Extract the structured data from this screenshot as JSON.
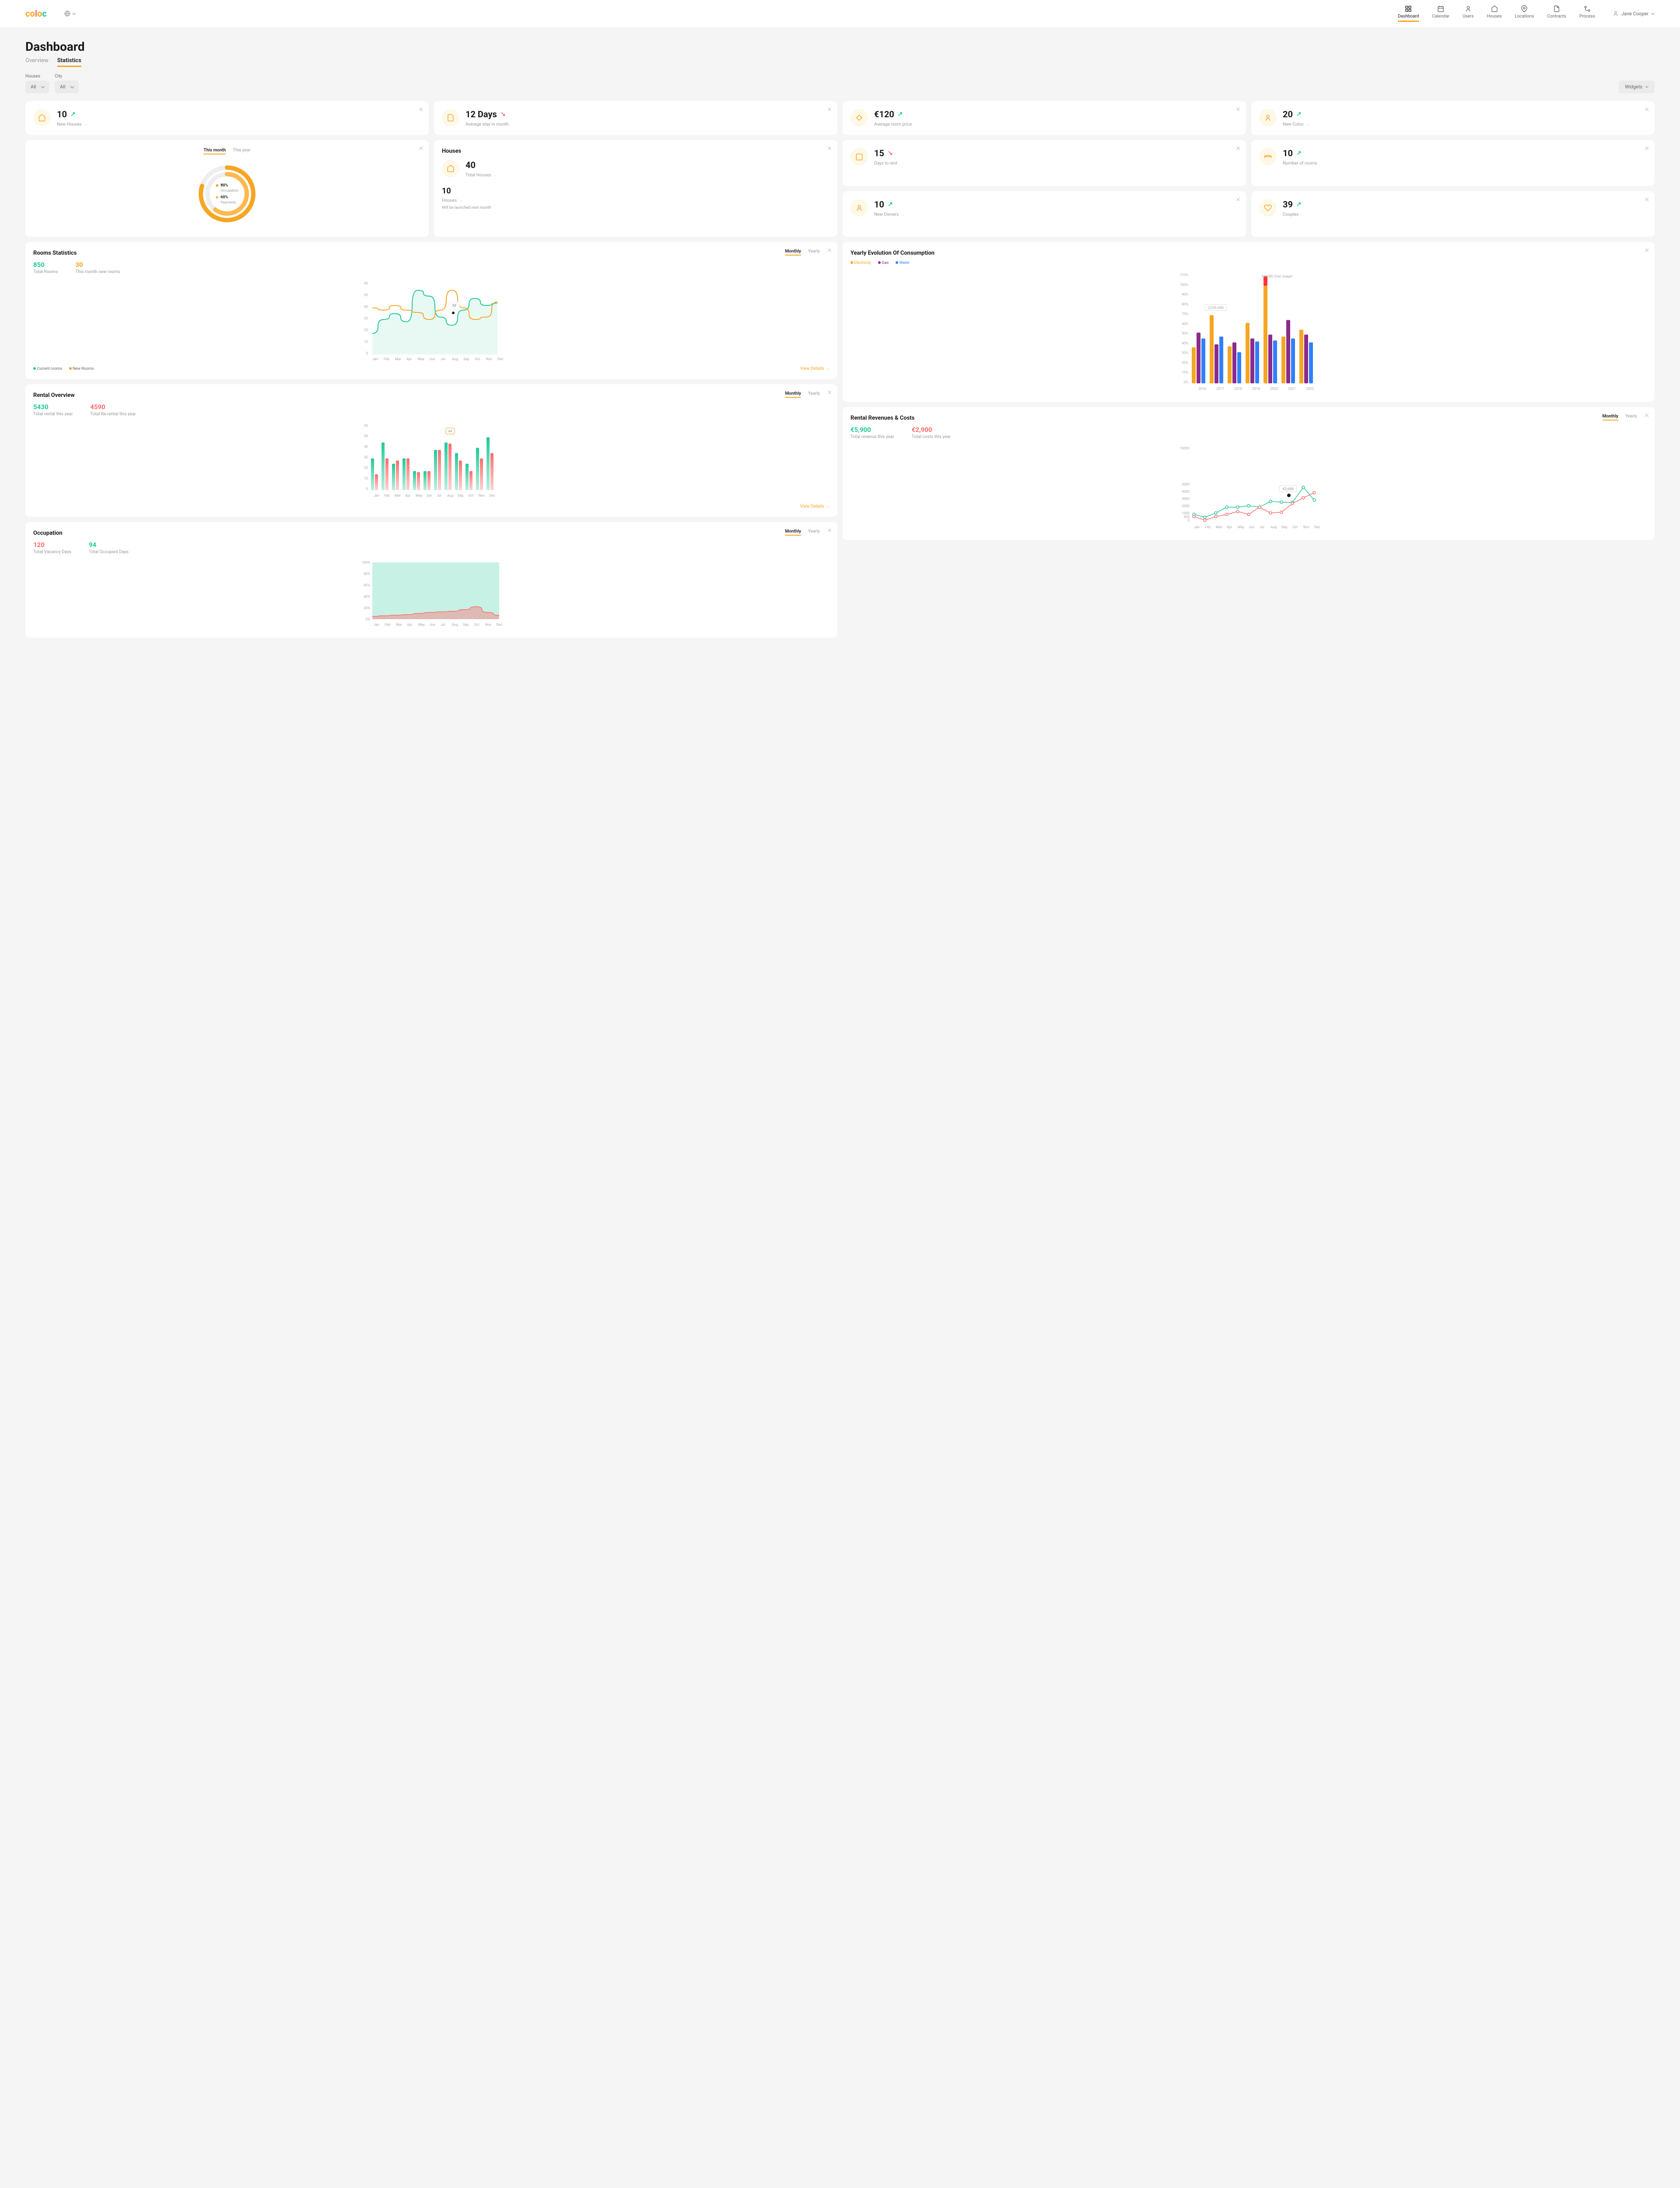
{
  "brand": "coloc",
  "nav": [
    {
      "label": "Dashboard",
      "active": true
    },
    {
      "label": "Calendar"
    },
    {
      "label": "Users"
    },
    {
      "label": "Houses"
    },
    {
      "label": "Locations"
    },
    {
      "label": "Contracts"
    },
    {
      "label": "Process"
    }
  ],
  "user_name": "Jane Cooper",
  "page_title": "Dashboard",
  "tabs": [
    {
      "label": "Overview",
      "active": false
    },
    {
      "label": "Statistics",
      "active": true
    }
  ],
  "filters": {
    "houses_label": "Houses",
    "city_label": "City",
    "all_option": "All",
    "widgets_label": "Widgets"
  },
  "kpis": {
    "new_houses": {
      "value": "10",
      "label": "New Houses",
      "trend": "up"
    },
    "avg_stay": {
      "value": "12 Days",
      "label": "Average stay in month",
      "trend": "down"
    },
    "avg_room_price": {
      "value": "€120",
      "label": "Average room price",
      "trend": "up"
    },
    "new_coloc": {
      "value": "20",
      "label": "New Coloc",
      "trend": "up"
    },
    "days_to_rent": {
      "value": "15",
      "label": "Days to rent",
      "trend": "down"
    },
    "num_rooms": {
      "value": "10",
      "label": "Number of rooms",
      "trend": "up"
    },
    "new_owners": {
      "value": "10",
      "label": "New Owners",
      "trend": "up"
    },
    "couples": {
      "value": "39",
      "label": "Couples",
      "trend": "up"
    }
  },
  "donut": {
    "this_month": "This month",
    "this_year": "This year",
    "occupation_pct": "80%",
    "occupation_label": "Occupation",
    "payments_pct": "60%",
    "payments_label": "Payments"
  },
  "houses_panel": {
    "title": "Houses",
    "total_value": "40",
    "total_label": "Total Houses",
    "launch_value": "10",
    "launch_label": "Houses",
    "launch_note": "Will be launched next month"
  },
  "rooms_stats": {
    "title": "Rooms Statistics",
    "monthly": "Monthly",
    "yearly": "Yearly",
    "total_rooms_val": "850",
    "total_rooms_label": "Total Rooms",
    "new_rooms_val": "30",
    "new_rooms_label": "This month new rooms",
    "legend_current": "Current rooms",
    "legend_new": "New Rooms",
    "tooltip": "38",
    "view_details": "View Details"
  },
  "rental_overview": {
    "title": "Rental Overview",
    "monthly": "Monthly",
    "yearly": "Yearly",
    "total_rental_val": "5430",
    "total_rental_label": "Total rental this year",
    "total_rerental_val": "4590",
    "total_rerental_label": "Total Re-rental this year",
    "tooltip": "44",
    "view_details": "View Details"
  },
  "occupation": {
    "title": "Occupation",
    "monthly": "Monthly",
    "yearly": "Yearly",
    "vacancy_val": "120",
    "vacancy_label": "Total Vacancy Days",
    "occupied_val": "94",
    "occupied_label": "Total Occupied Days"
  },
  "consumption": {
    "title": "Yearly Evolution Of Consumption",
    "electricity": "Electricity",
    "gas": "Gas",
    "water": "Water",
    "tooltip1": "2,036 kWh",
    "tooltip2": "64 kWh Over usage!"
  },
  "revenues": {
    "title": "Rental Revenues & Costs",
    "monthly": "Monthly",
    "yearly": "Yearly",
    "revenue_val": "€5,900",
    "revenue_label": "Total revenus this year",
    "cost_val": "€2,900",
    "cost_label": "Total costs this year",
    "tooltip": "€2,650"
  },
  "months": [
    "Jan",
    "Feb",
    "Mar",
    "Apr",
    "May",
    "Jun",
    "Jul",
    "Aug",
    "Sep",
    "Oct",
    "Nov",
    "Dec"
  ],
  "years": [
    "2016",
    "2017",
    "2018",
    "2019",
    "2020",
    "2021",
    "2022"
  ],
  "chart_data": {
    "rooms_statistics": {
      "type": "line",
      "categories": [
        "Jan",
        "Feb",
        "Mar",
        "Apr",
        "May",
        "Jun",
        "Jul",
        "Aug",
        "Sep",
        "Oct",
        "Nov",
        "Dec"
      ],
      "series": [
        {
          "name": "Current rooms",
          "values": [
            18,
            30,
            35,
            28,
            55,
            50,
            32,
            25,
            38,
            48,
            42,
            44
          ]
        },
        {
          "name": "New Rooms",
          "values": [
            40,
            38,
            42,
            38,
            36,
            30,
            38,
            55,
            40,
            30,
            32,
            45
          ]
        }
      ],
      "ylim": [
        0,
        60
      ]
    },
    "rental_overview": {
      "type": "bar",
      "categories": [
        "Jan",
        "Feb",
        "Mar",
        "Apr",
        "May",
        "Jun",
        "Jul",
        "Aug",
        "Sep",
        "Oct",
        "Nov",
        "Dec"
      ],
      "series": [
        {
          "name": "Rental",
          "values": [
            30,
            45,
            25,
            30,
            18,
            18,
            38,
            45,
            35,
            25,
            40,
            50
          ]
        },
        {
          "name": "Re-rental",
          "values": [
            15,
            30,
            28,
            30,
            17,
            18,
            38,
            44,
            28,
            18,
            30,
            35
          ]
        }
      ],
      "ylim": [
        0,
        60
      ]
    },
    "occupation": {
      "type": "area",
      "categories": [
        "Jan",
        "Feb",
        "Mar",
        "Apr",
        "May",
        "Jun",
        "Jul",
        "Aug",
        "Sep",
        "Oct",
        "Nov",
        "Dec"
      ],
      "series": [
        {
          "name": "Occupied",
          "values": [
            100,
            100,
            100,
            100,
            100,
            100,
            100,
            100,
            100,
            100,
            100,
            100
          ]
        },
        {
          "name": "Vacancy",
          "values": [
            5,
            6,
            7,
            8,
            10,
            12,
            13,
            14,
            17,
            22,
            12,
            7
          ]
        }
      ],
      "ylim": [
        0,
        100
      ]
    },
    "consumption": {
      "type": "bar",
      "categories": [
        "2016",
        "2017",
        "2018",
        "2019",
        "2020",
        "2021",
        "2022"
      ],
      "series": [
        {
          "name": "Electricity",
          "values": [
            37,
            70,
            38,
            62,
            110,
            48,
            55
          ]
        },
        {
          "name": "Gas",
          "values": [
            52,
            40,
            42,
            46,
            50,
            65,
            50
          ]
        },
        {
          "name": "Water",
          "values": [
            46,
            48,
            32,
            43,
            44,
            46,
            42
          ]
        }
      ],
      "ylim": [
        0,
        110
      ]
    },
    "revenues_costs": {
      "type": "line",
      "categories": [
        "Jan",
        "Feb",
        "Mar",
        "Apr",
        "May",
        "Jun",
        "Jul",
        "Aug",
        "Sep",
        "Oct",
        "Nov",
        "Dec"
      ],
      "series": [
        {
          "name": "Revenue",
          "values": [
            1000,
            600,
            1200,
            2000,
            2000,
            2200,
            2000,
            2800,
            2700,
            2650,
            4750,
            3000
          ]
        },
        {
          "name": "Cost",
          "values": [
            700,
            200,
            700,
            1000,
            1400,
            1000,
            2000,
            1200,
            1300,
            2500,
            3300,
            4000
          ]
        }
      ],
      "ylim": [
        0,
        10000
      ]
    },
    "donut": {
      "type": "pie",
      "series": [
        {
          "name": "Occupation",
          "value": 80
        },
        {
          "name": "Payments",
          "value": 60
        }
      ]
    }
  }
}
